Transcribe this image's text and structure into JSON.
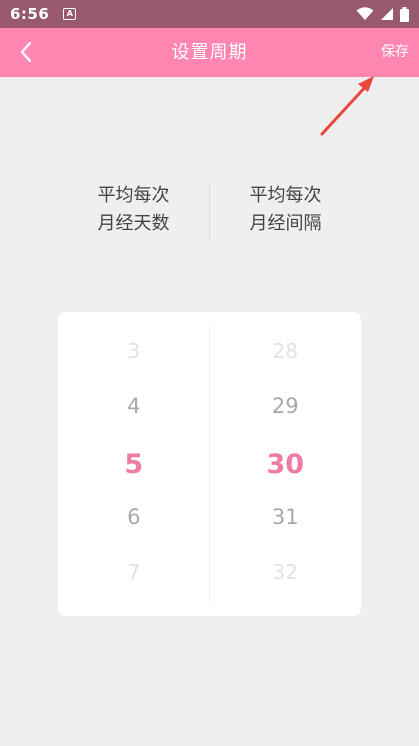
{
  "status_bar": {
    "time": "6:56",
    "notification_badge": "A"
  },
  "app_bar": {
    "title": "设置周期",
    "save_label": "保存"
  },
  "labels": {
    "left_line1": "平均每次",
    "left_line2": "月经天数",
    "right_line1": "平均每次",
    "right_line2": "月经间隔"
  },
  "picker": {
    "left": [
      "3",
      "4",
      "5",
      "6",
      "7"
    ],
    "right": [
      "28",
      "29",
      "30",
      "31",
      "32"
    ]
  },
  "colors": {
    "status_bar": "#985870",
    "app_bar": "#ff86b0",
    "selected": "#ef7aa4",
    "annotation_arrow": "#e8473a"
  }
}
